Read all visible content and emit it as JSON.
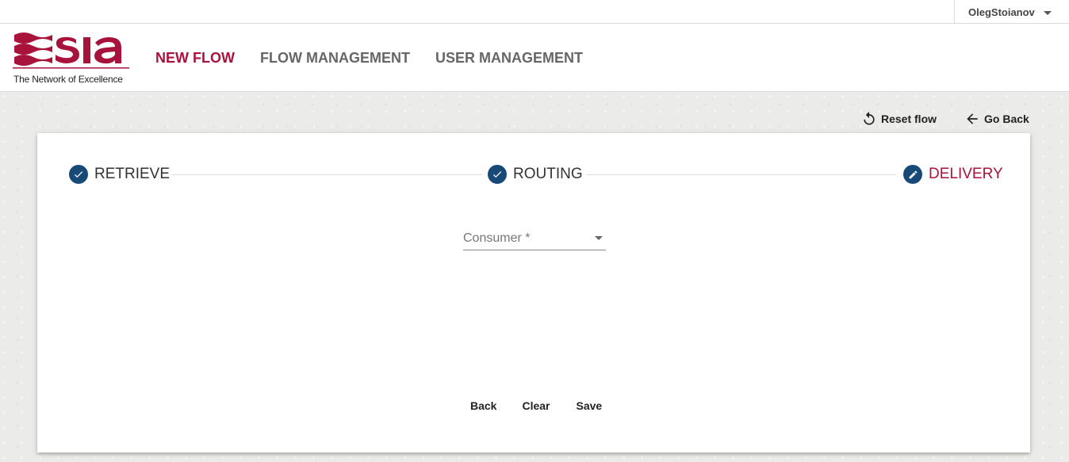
{
  "user": {
    "name": "OlegStoianov"
  },
  "logo": {
    "tagline": "The Network of Excellence"
  },
  "nav": [
    {
      "label": "NEW FLOW",
      "active": true
    },
    {
      "label": "FLOW MANAGEMENT",
      "active": false
    },
    {
      "label": "USER MANAGEMENT",
      "active": false
    }
  ],
  "actions": {
    "reset": "Reset flow",
    "back": "Go Back"
  },
  "steps": [
    {
      "label": "RETRIEVE",
      "state": "done"
    },
    {
      "label": "ROUTING",
      "state": "done"
    },
    {
      "label": "DELIVERY",
      "state": "current"
    }
  ],
  "form": {
    "consumer_placeholder": "Consumer *"
  },
  "buttons": {
    "back": "Back",
    "clear": "Clear",
    "save": "Save"
  },
  "colors": {
    "brand": "#a8133b",
    "step": "#184a78"
  }
}
